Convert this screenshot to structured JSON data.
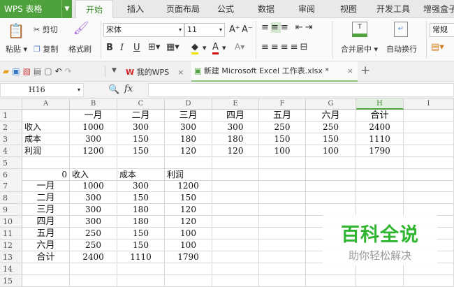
{
  "app": {
    "name": "WPS 表格"
  },
  "menu_tabs": [
    "开始",
    "插入",
    "页面布局",
    "公式",
    "数据",
    "审阅",
    "视图",
    "开发工具",
    "增强盒子"
  ],
  "active_tab": "开始",
  "ribbon": {
    "paste": "粘贴",
    "cut": "剪切",
    "copy": "复制",
    "format_painter": "格式刷",
    "font_name": "宋体",
    "font_size": "11",
    "bold": "B",
    "italic": "I",
    "underline": "U",
    "merge_center": "合并居中",
    "wrap_text": "自动换行",
    "number_format": "常规"
  },
  "doc_tabs": [
    {
      "label": "我的WPS"
    },
    {
      "label": "新建 Microsoft Excel 工作表.xlsx *",
      "active": true
    }
  ],
  "formula_bar": {
    "cell_ref": "H16",
    "fx": "fx",
    "value": ""
  },
  "columns": [
    "A",
    "B",
    "C",
    "D",
    "E",
    "F",
    "G",
    "H",
    "I"
  ],
  "selected_column": "H",
  "rows": [
    [
      "",
      "一月",
      "二月",
      "三月",
      "四月",
      "五月",
      "六月",
      "合计",
      ""
    ],
    [
      "收入",
      "1000",
      "300",
      "300",
      "300",
      "250",
      "250",
      "2400",
      ""
    ],
    [
      "成本",
      "300",
      "150",
      "180",
      "180",
      "150",
      "150",
      "1110",
      ""
    ],
    [
      "利润",
      "1200",
      "150",
      "120",
      "120",
      "100",
      "100",
      "1790",
      ""
    ],
    [
      "",
      "",
      "",
      "",
      "",
      "",
      "",
      "",
      ""
    ],
    [
      "0",
      "收入",
      "成本",
      "利润",
      "",
      "",
      "",
      "",
      ""
    ],
    [
      "一月",
      "1000",
      "300",
      "1200",
      "",
      "",
      "",
      "",
      ""
    ],
    [
      "二月",
      "300",
      "150",
      "150",
      "",
      "",
      "",
      "",
      ""
    ],
    [
      "三月",
      "300",
      "180",
      "120",
      "",
      "",
      "",
      "",
      ""
    ],
    [
      "四月",
      "300",
      "180",
      "120",
      "",
      "",
      "",
      "",
      ""
    ],
    [
      "五月",
      "250",
      "150",
      "100",
      "",
      "",
      "",
      "",
      ""
    ],
    [
      "六月",
      "250",
      "150",
      "100",
      "",
      "",
      "",
      "",
      ""
    ],
    [
      "合计",
      "2400",
      "1110",
      "1790",
      "",
      "",
      "",
      "",
      ""
    ],
    [
      "",
      "",
      "",
      "",
      "",
      "",
      "",
      "",
      ""
    ],
    [
      "",
      "",
      "",
      "",
      "",
      "",
      "",
      "",
      ""
    ]
  ],
  "watermark": {
    "title": "百科全说",
    "subtitle": "助你轻松解决",
    "color": "#2fb52f"
  }
}
